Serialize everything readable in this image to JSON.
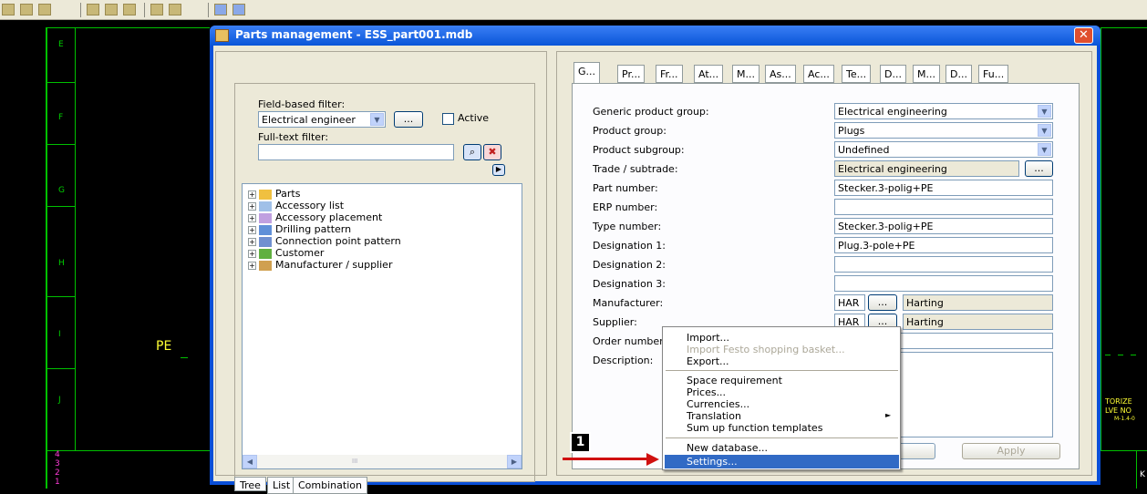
{
  "window": {
    "title": "Parts management - ESS_part001.mdb",
    "close_glyph": "✕"
  },
  "cad": {
    "row_letters": [
      "E",
      "F",
      "G",
      "H",
      "I",
      "J"
    ],
    "numbers": [
      "4",
      "3",
      "2",
      "1"
    ],
    "pe_label": "PE",
    "right_text": [
      "TORIZE",
      "LVE NO",
      "M-1.4-0"
    ],
    "right_letter": "K"
  },
  "filter": {
    "field_label": "Field-based filter:",
    "field_value": "Electrical engineer",
    "browse": "...",
    "active_label": "Active",
    "fulltext_label": "Full-text filter:",
    "fulltext_value": ""
  },
  "tree": {
    "items": [
      {
        "label": "Parts",
        "icon": "folder-icon"
      },
      {
        "label": "Accessory list",
        "icon": "list-icon"
      },
      {
        "label": "Accessory placement",
        "icon": "placement-icon"
      },
      {
        "label": "Drilling pattern",
        "icon": "drilling-icon"
      },
      {
        "label": "Connection point pattern",
        "icon": "connection-icon"
      },
      {
        "label": "Customer",
        "icon": "customer-icon"
      },
      {
        "label": "Manufacturer / supplier",
        "icon": "manufacturer-icon"
      }
    ],
    "scroll_thumb": "III"
  },
  "bottom_tabs": [
    "Tree",
    "List",
    "Combination"
  ],
  "tabs": [
    "G...",
    "Pr...",
    "Fr...",
    "At...",
    "M...",
    "As...",
    "Ac...",
    "Te...",
    "D...",
    "M...",
    "D...",
    "Fu..."
  ],
  "form": {
    "generic_group_label": "Generic product group:",
    "generic_group_value": "Electrical engineering",
    "group_label": "Product group:",
    "group_value": "Plugs",
    "subgroup_label": "Product subgroup:",
    "subgroup_value": "Undefined",
    "trade_label": "Trade / subtrade:",
    "trade_value": "Electrical engineering",
    "part_number_label": "Part number:",
    "part_number_value": "Stecker.3-polig+PE",
    "erp_label": "ERP number:",
    "erp_value": "",
    "type_label": "Type number:",
    "type_value": "Stecker.3-polig+PE",
    "designation1_label": "Designation 1:",
    "designation1_value": "Plug.3-pole+PE",
    "designation2_label": "Designation 2:",
    "designation3_label": "Designation 3:",
    "manufacturer_label": "Manufacturer:",
    "manufacturer_code": "HAR",
    "manufacturer_name": "Harting",
    "supplier_label": "Supplier:",
    "supplier_code": "HAR",
    "supplier_name": "Harting",
    "order_label": "Order number:",
    "description_label": "Description:"
  },
  "context_menu": {
    "items": [
      "Import...",
      "Import Festo shopping basket...",
      "Export...",
      "Space requirement",
      "Prices...",
      "Currencies...",
      "Translation",
      "Sum up function templates",
      "New database...",
      "Settings..."
    ],
    "submenu_glyph": "►"
  },
  "buttons": {
    "apply": "Apply"
  },
  "annotation": {
    "badge": "1"
  },
  "colors": {
    "title_bar": "#0a55d8",
    "dialog_bg": "#ece9d8",
    "menu_highlight": "#316ac5",
    "cad_green": "#00c000"
  }
}
